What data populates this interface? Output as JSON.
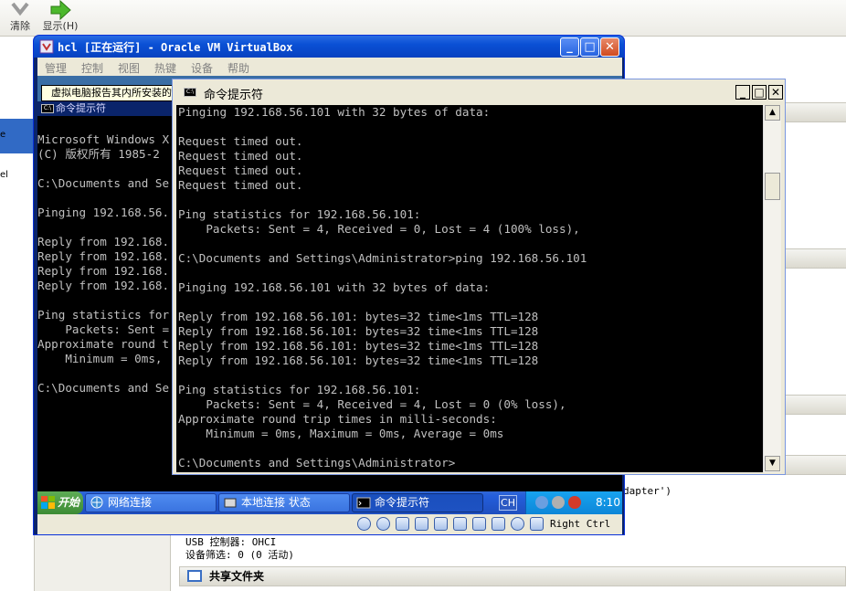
{
  "host": {
    "toolbar": {
      "clear_label": "清除",
      "show_label": "显示(H)"
    },
    "left_panel": {
      "text_e": "e",
      "text_el": "el"
    },
    "right_snippet": "dapter')",
    "bottom": {
      "usb_controller": "USB 控制器:  OHCI",
      "device_filter": "设备筛选:   0 (0 活动)",
      "shared_folders": "共享文件夹"
    }
  },
  "vm_window": {
    "title": "hcl [正在运行] - Oracle VM VirtualBox",
    "menu": [
      "管理",
      "控制",
      "视图",
      "热键",
      "设备",
      "帮助"
    ],
    "status_text": "Right Ctrl"
  },
  "guest": {
    "balloon": "虚拟电脑报告其内所安装的",
    "back_console": {
      "title": "命令提示符",
      "lines": [
        "Microsoft Windows X",
        "(C) 版权所有 1985-2",
        "",
        "C:\\Documents and Se",
        "",
        "Pinging 192.168.56.",
        "",
        "Reply from 192.168.",
        "Reply from 192.168.",
        "Reply from 192.168.",
        "Reply from 192.168.",
        "",
        "Ping statistics for",
        "    Packets: Sent =",
        "Approximate round t",
        "    Minimum = 0ms,",
        "",
        "C:\\Documents and Se"
      ]
    },
    "front_console": {
      "title": "命令提示符",
      "lines": [
        "Pinging 192.168.56.101 with 32 bytes of data:",
        "",
        "Request timed out.",
        "Request timed out.",
        "Request timed out.",
        "Request timed out.",
        "",
        "Ping statistics for 192.168.56.101:",
        "    Packets: Sent = 4, Received = 0, Lost = 4 (100% loss),",
        "",
        "C:\\Documents and Settings\\Administrator>ping 192.168.56.101",
        "",
        "Pinging 192.168.56.101 with 32 bytes of data:",
        "",
        "Reply from 192.168.56.101: bytes=32 time<1ms TTL=128",
        "Reply from 192.168.56.101: bytes=32 time<1ms TTL=128",
        "Reply from 192.168.56.101: bytes=32 time<1ms TTL=128",
        "Reply from 192.168.56.101: bytes=32 time<1ms TTL=128",
        "",
        "Ping statistics for 192.168.56.101:",
        "    Packets: Sent = 4, Received = 4, Lost = 0 (0% loss),",
        "Approximate round trip times in milli-seconds:",
        "    Minimum = 0ms, Maximum = 0ms, Average = 0ms",
        "",
        "C:\\Documents and Settings\\Administrator>"
      ]
    },
    "taskbar": {
      "start_label": "开始",
      "tasks": [
        "网络连接",
        "本地连接 状态",
        "命令提示符"
      ],
      "lang": "CH",
      "clock": "8:10"
    }
  },
  "colors": {
    "console_bg": "#000000",
    "console_fg": "#c0c0c0",
    "xp_blue": "#245edb",
    "start_green": "#3c8b34"
  }
}
